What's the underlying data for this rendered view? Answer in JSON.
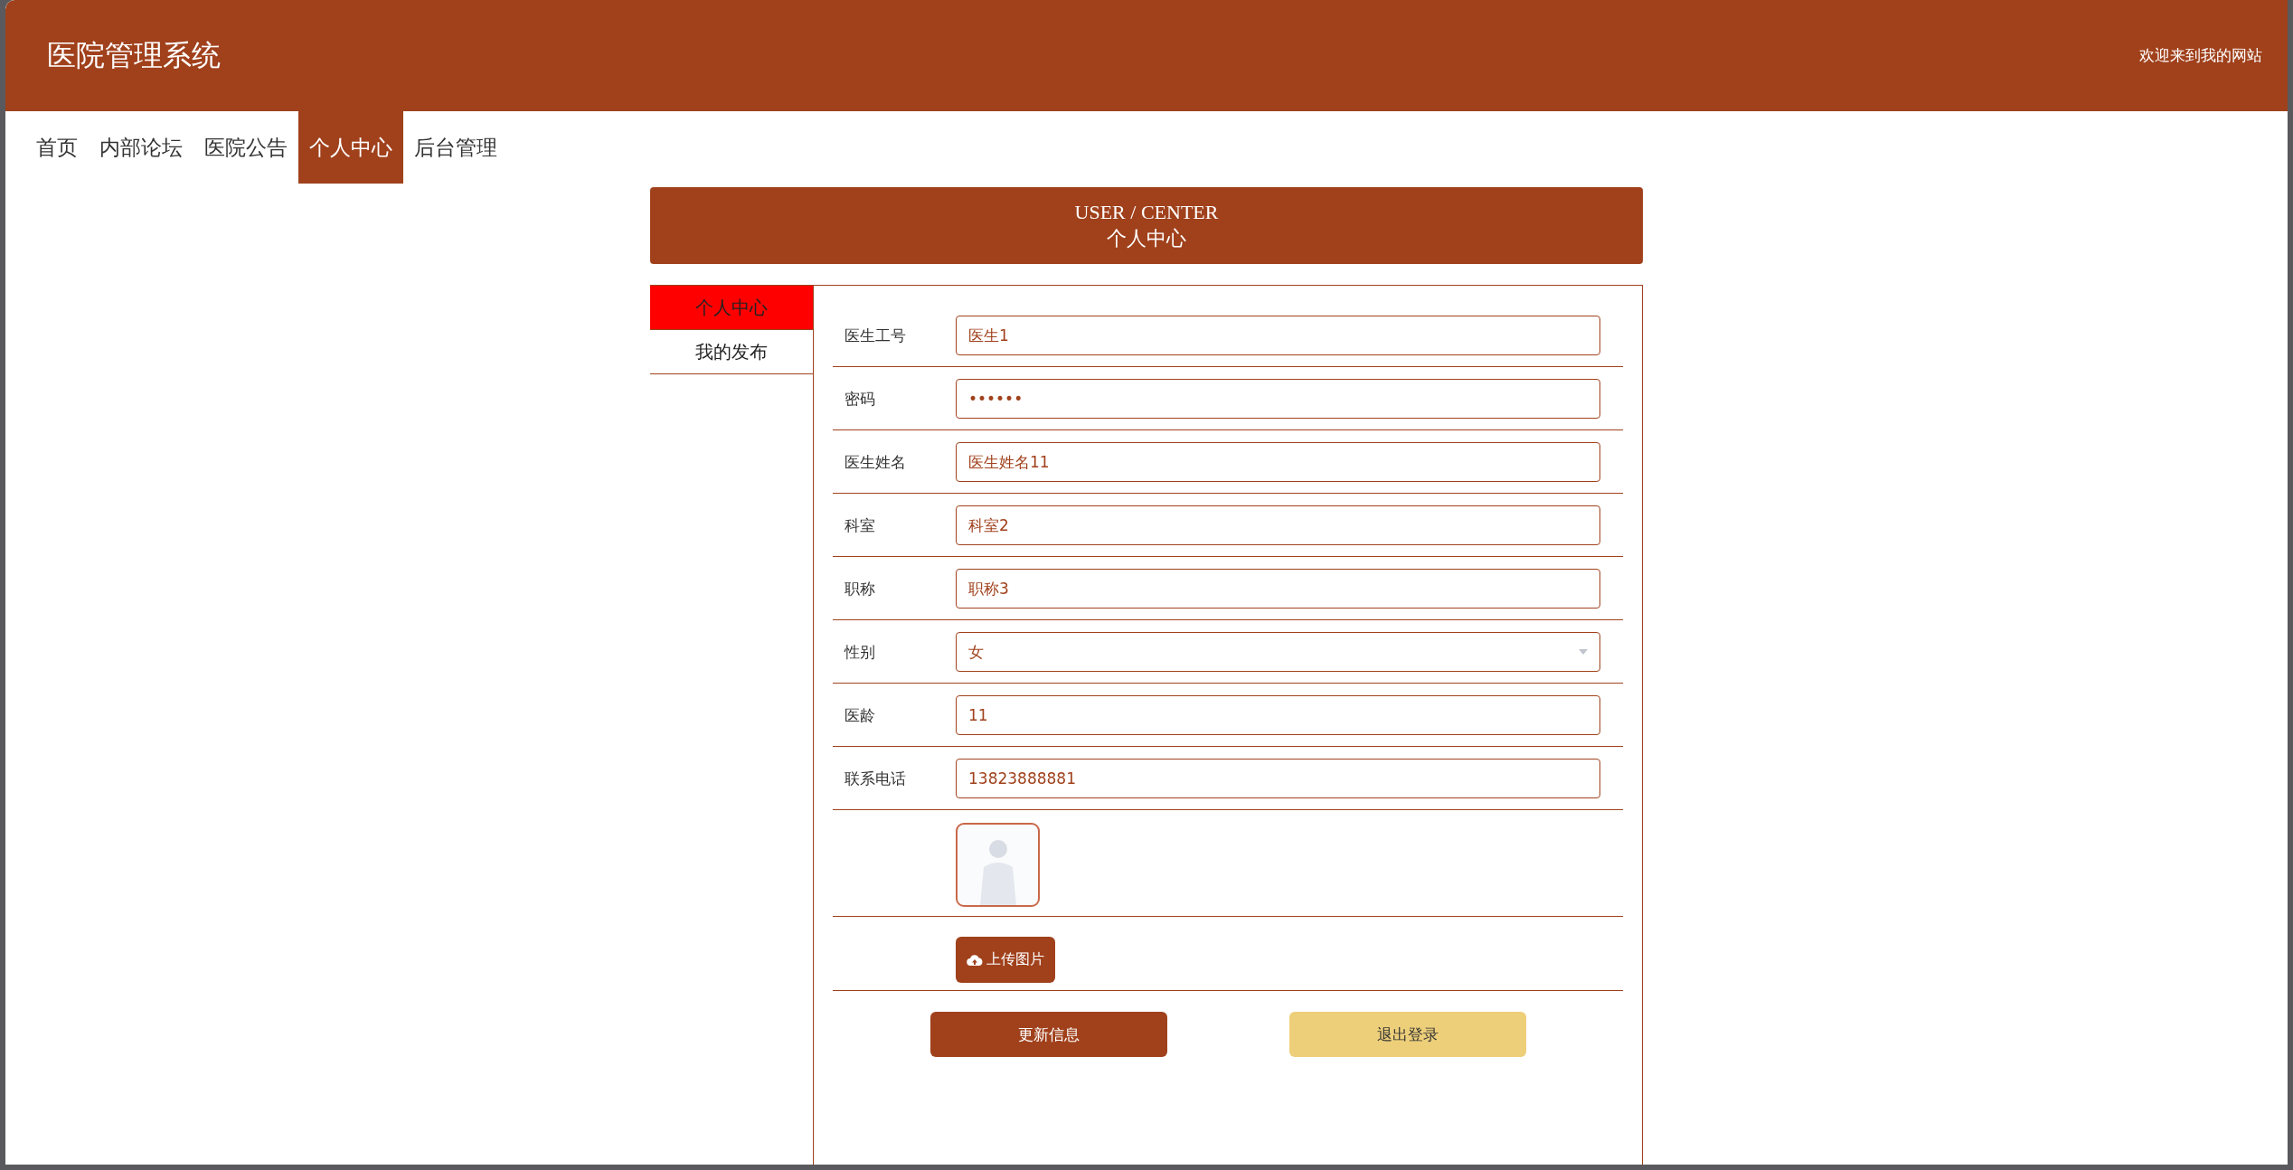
{
  "header": {
    "title": "医院管理系统",
    "welcome": "欢迎来到我的网站"
  },
  "nav": [
    {
      "label": "首页",
      "selected": false
    },
    {
      "label": "内部论坛",
      "selected": false
    },
    {
      "label": "医院公告",
      "selected": false
    },
    {
      "label": "个人中心",
      "selected": true
    },
    {
      "label": "后台管理",
      "selected": false
    }
  ],
  "banner": {
    "title_en": "USER / CENTER",
    "title_cn": "个人中心"
  },
  "sidebar": [
    {
      "label": "个人中心",
      "selected": true
    },
    {
      "label": "我的发布",
      "selected": false
    }
  ],
  "form": [
    {
      "kind": "text",
      "label": "医生工号",
      "value": "医生1"
    },
    {
      "kind": "password",
      "label": "密码",
      "value": "••••••"
    },
    {
      "kind": "text",
      "label": "医生姓名",
      "value": "医生姓名11"
    },
    {
      "kind": "text",
      "label": "科室",
      "value": "科室2"
    },
    {
      "kind": "text",
      "label": "职称",
      "value": "职称3"
    },
    {
      "kind": "select",
      "label": "性别",
      "value": "女"
    },
    {
      "kind": "text",
      "label": "医龄",
      "value": "11"
    },
    {
      "kind": "text",
      "label": "联系电话",
      "value": "13823888881"
    },
    {
      "kind": "image"
    },
    {
      "kind": "upload",
      "button": "上传图片"
    }
  ],
  "buttons": [
    {
      "kind": "primary",
      "label": "更新信息"
    },
    {
      "kind": "secondary",
      "label": "退出登录"
    }
  ]
}
